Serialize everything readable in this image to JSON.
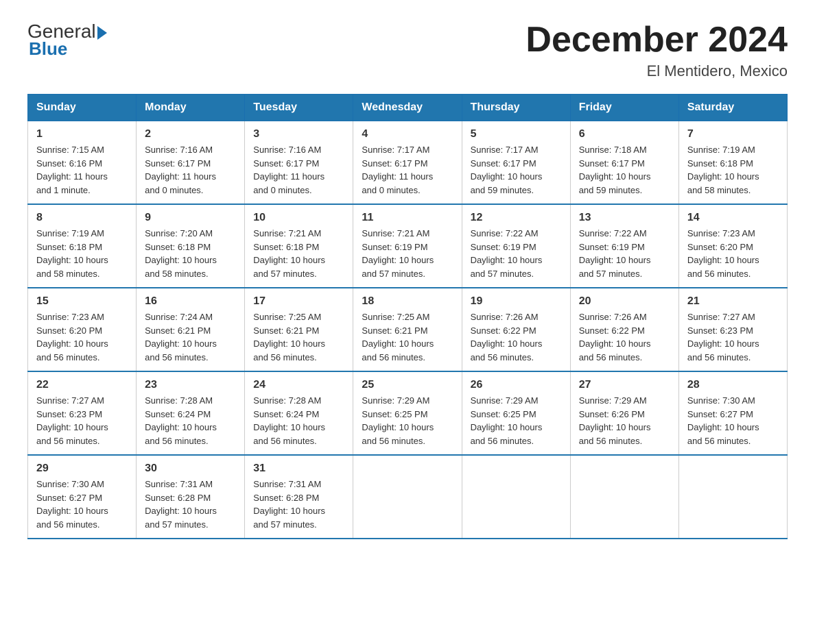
{
  "header": {
    "logo_general": "General",
    "logo_blue": "Blue",
    "title": "December 2024",
    "subtitle": "El Mentidero, Mexico"
  },
  "weekdays": [
    "Sunday",
    "Monday",
    "Tuesday",
    "Wednesday",
    "Thursday",
    "Friday",
    "Saturday"
  ],
  "weeks": [
    [
      {
        "day": "1",
        "sunrise": "7:15 AM",
        "sunset": "6:16 PM",
        "daylight": "11 hours and 1 minute."
      },
      {
        "day": "2",
        "sunrise": "7:16 AM",
        "sunset": "6:17 PM",
        "daylight": "11 hours and 0 minutes."
      },
      {
        "day": "3",
        "sunrise": "7:16 AM",
        "sunset": "6:17 PM",
        "daylight": "11 hours and 0 minutes."
      },
      {
        "day": "4",
        "sunrise": "7:17 AM",
        "sunset": "6:17 PM",
        "daylight": "11 hours and 0 minutes."
      },
      {
        "day": "5",
        "sunrise": "7:17 AM",
        "sunset": "6:17 PM",
        "daylight": "10 hours and 59 minutes."
      },
      {
        "day": "6",
        "sunrise": "7:18 AM",
        "sunset": "6:17 PM",
        "daylight": "10 hours and 59 minutes."
      },
      {
        "day": "7",
        "sunrise": "7:19 AM",
        "sunset": "6:18 PM",
        "daylight": "10 hours and 58 minutes."
      }
    ],
    [
      {
        "day": "8",
        "sunrise": "7:19 AM",
        "sunset": "6:18 PM",
        "daylight": "10 hours and 58 minutes."
      },
      {
        "day": "9",
        "sunrise": "7:20 AM",
        "sunset": "6:18 PM",
        "daylight": "10 hours and 58 minutes."
      },
      {
        "day": "10",
        "sunrise": "7:21 AM",
        "sunset": "6:18 PM",
        "daylight": "10 hours and 57 minutes."
      },
      {
        "day": "11",
        "sunrise": "7:21 AM",
        "sunset": "6:19 PM",
        "daylight": "10 hours and 57 minutes."
      },
      {
        "day": "12",
        "sunrise": "7:22 AM",
        "sunset": "6:19 PM",
        "daylight": "10 hours and 57 minutes."
      },
      {
        "day": "13",
        "sunrise": "7:22 AM",
        "sunset": "6:19 PM",
        "daylight": "10 hours and 57 minutes."
      },
      {
        "day": "14",
        "sunrise": "7:23 AM",
        "sunset": "6:20 PM",
        "daylight": "10 hours and 56 minutes."
      }
    ],
    [
      {
        "day": "15",
        "sunrise": "7:23 AM",
        "sunset": "6:20 PM",
        "daylight": "10 hours and 56 minutes."
      },
      {
        "day": "16",
        "sunrise": "7:24 AM",
        "sunset": "6:21 PM",
        "daylight": "10 hours and 56 minutes."
      },
      {
        "day": "17",
        "sunrise": "7:25 AM",
        "sunset": "6:21 PM",
        "daylight": "10 hours and 56 minutes."
      },
      {
        "day": "18",
        "sunrise": "7:25 AM",
        "sunset": "6:21 PM",
        "daylight": "10 hours and 56 minutes."
      },
      {
        "day": "19",
        "sunrise": "7:26 AM",
        "sunset": "6:22 PM",
        "daylight": "10 hours and 56 minutes."
      },
      {
        "day": "20",
        "sunrise": "7:26 AM",
        "sunset": "6:22 PM",
        "daylight": "10 hours and 56 minutes."
      },
      {
        "day": "21",
        "sunrise": "7:27 AM",
        "sunset": "6:23 PM",
        "daylight": "10 hours and 56 minutes."
      }
    ],
    [
      {
        "day": "22",
        "sunrise": "7:27 AM",
        "sunset": "6:23 PM",
        "daylight": "10 hours and 56 minutes."
      },
      {
        "day": "23",
        "sunrise": "7:28 AM",
        "sunset": "6:24 PM",
        "daylight": "10 hours and 56 minutes."
      },
      {
        "day": "24",
        "sunrise": "7:28 AM",
        "sunset": "6:24 PM",
        "daylight": "10 hours and 56 minutes."
      },
      {
        "day": "25",
        "sunrise": "7:29 AM",
        "sunset": "6:25 PM",
        "daylight": "10 hours and 56 minutes."
      },
      {
        "day": "26",
        "sunrise": "7:29 AM",
        "sunset": "6:25 PM",
        "daylight": "10 hours and 56 minutes."
      },
      {
        "day": "27",
        "sunrise": "7:29 AM",
        "sunset": "6:26 PM",
        "daylight": "10 hours and 56 minutes."
      },
      {
        "day": "28",
        "sunrise": "7:30 AM",
        "sunset": "6:27 PM",
        "daylight": "10 hours and 56 minutes."
      }
    ],
    [
      {
        "day": "29",
        "sunrise": "7:30 AM",
        "sunset": "6:27 PM",
        "daylight": "10 hours and 56 minutes."
      },
      {
        "day": "30",
        "sunrise": "7:31 AM",
        "sunset": "6:28 PM",
        "daylight": "10 hours and 57 minutes."
      },
      {
        "day": "31",
        "sunrise": "7:31 AM",
        "sunset": "6:28 PM",
        "daylight": "10 hours and 57 minutes."
      },
      null,
      null,
      null,
      null
    ]
  ]
}
